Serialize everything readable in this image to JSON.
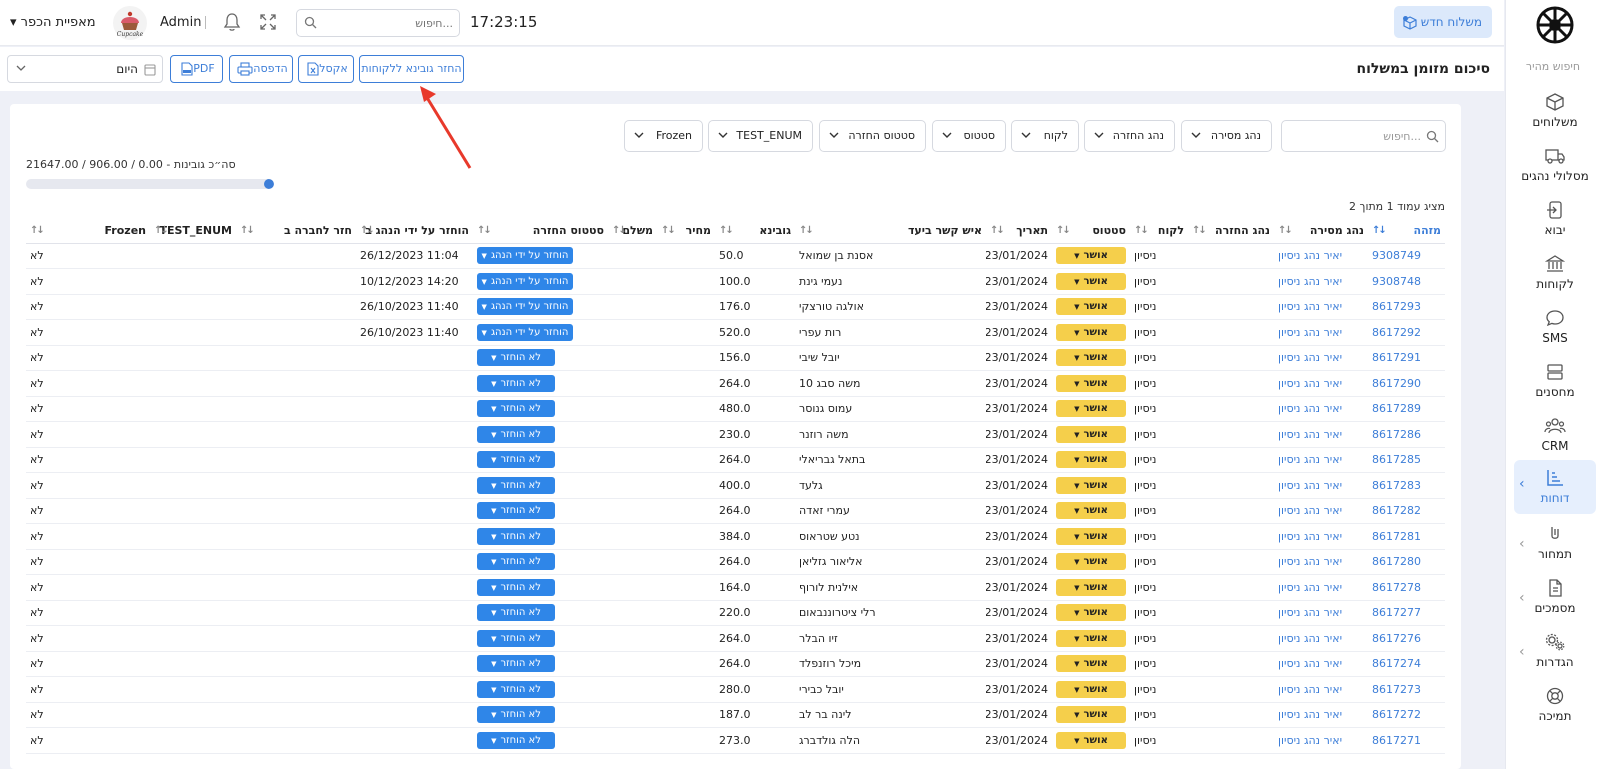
{
  "sidebar": {
    "quick_search": "חיפוש מהיר",
    "items": [
      {
        "label": "משלוחים",
        "icon": "box-icon"
      },
      {
        "label": "מסלולי נהגים",
        "icon": "truck-icon"
      },
      {
        "label": "יבוא",
        "icon": "import-icon"
      },
      {
        "label": "לקוחות",
        "icon": "bank-icon"
      },
      {
        "label": "SMS",
        "icon": "chat-icon"
      },
      {
        "label": "מחסנים",
        "icon": "warehouse-icon"
      },
      {
        "label": "CRM",
        "icon": "users-icon"
      },
      {
        "label": "דוחות",
        "icon": "report-icon"
      },
      {
        "label": "תמחור",
        "icon": "pricing-icon"
      },
      {
        "label": "מסמכים",
        "icon": "document-icon"
      },
      {
        "label": "הגדרות",
        "icon": "gear-icon"
      },
      {
        "label": "תמיכה",
        "icon": "support-icon"
      }
    ]
  },
  "header": {
    "new_shipment": "משלוח חדש",
    "time": "17:23:15",
    "search_placeholder": "חיפוש...",
    "user": "Admin",
    "brand_text": "Cupcake",
    "business": "מאפיית הכפר"
  },
  "toolbar": {
    "title": "סיכום מזומן במשלוח",
    "return_cash": "החזר גובינא ללקוחות",
    "excel": "אקסל",
    "print": "הדפסה",
    "pdf": "PDF",
    "date_value": "היום"
  },
  "filters": {
    "search_placeholder": "חיפוש...",
    "buttons": [
      "נהג מסירה",
      "נהג החזרה",
      "לקוח",
      "סטטוס",
      "סטטוס החזרה",
      "TEST_ENUM",
      "Frozen"
    ]
  },
  "totals": {
    "text": "סה״כ גובינות - 0.00 / 906.00 / 21647.00",
    "progress_fraction": 0.04
  },
  "page_info": "מציג עמוד 1 מתוך 2",
  "table": {
    "columns": [
      "מזהה",
      "נהג מסירה",
      "נהג החזרה",
      "לקוח",
      "סטטוס",
      "תאריך",
      "איש קשר ביעד",
      "גובינא",
      "מחיר",
      "משלם",
      "סטטוס החזרה",
      "הוחזר על ידי הנהג ב",
      "חזר לחברה ב",
      "TEST_ENUM",
      "Frozen"
    ],
    "rows": [
      {
        "id": "9308749",
        "driver": "יאיר נהג ניסיון",
        "return_driver": "",
        "customer": "ניסיון",
        "status": "אושר",
        "date": "23/01/2024",
        "contact": "אסנת בן שמואל",
        "cod": "50.0",
        "price": "",
        "payer": "",
        "return_status": "הוחזר על ידי הנהג",
        "returned_at": "11:04 26/12/2023",
        "company_at": "",
        "test_enum": "",
        "frozen": "לא"
      },
      {
        "id": "9308748",
        "driver": "יאיר נהג ניסיון",
        "return_driver": "",
        "customer": "ניסיון",
        "status": "אושר",
        "date": "23/01/2024",
        "contact": "נעמי גינת",
        "cod": "100.0",
        "price": "",
        "payer": "",
        "return_status": "הוחזר על ידי הנהג",
        "returned_at": "14:20 10/12/2023",
        "company_at": "",
        "test_enum": "",
        "frozen": "לא"
      },
      {
        "id": "8617293",
        "driver": "יאיר נהג ניסיון",
        "return_driver": "",
        "customer": "ניסיון",
        "status": "אושר",
        "date": "23/01/2024",
        "contact": "אולגה טורצקי",
        "cod": "176.0",
        "price": "",
        "payer": "",
        "return_status": "הוחזר על ידי הנהג",
        "returned_at": "11:40 26/10/2023",
        "company_at": "",
        "test_enum": "",
        "frozen": "לא"
      },
      {
        "id": "8617292",
        "driver": "יאיר נהג ניסיון",
        "return_driver": "",
        "customer": "ניסיון",
        "status": "אושר",
        "date": "23/01/2024",
        "contact": "רות עפרי",
        "cod": "520.0",
        "price": "",
        "payer": "",
        "return_status": "הוחזר על ידי הנהג",
        "returned_at": "11:40 26/10/2023",
        "company_at": "",
        "test_enum": "",
        "frozen": "לא"
      },
      {
        "id": "8617291",
        "driver": "יאיר נהג ניסיון",
        "return_driver": "",
        "customer": "ניסיון",
        "status": "אושר",
        "date": "23/01/2024",
        "contact": "יובל שיבי",
        "cod": "156.0",
        "price": "",
        "payer": "",
        "return_status": "לא הוחזר",
        "returned_at": "",
        "company_at": "",
        "test_enum": "",
        "frozen": "לא"
      },
      {
        "id": "8617290",
        "driver": "יאיר נהג ניסיון",
        "return_driver": "",
        "customer": "ניסיון",
        "status": "אושר",
        "date": "23/01/2024",
        "contact": "משה סבג 10",
        "cod": "264.0",
        "price": "",
        "payer": "",
        "return_status": "לא הוחזר",
        "returned_at": "",
        "company_at": "",
        "test_enum": "",
        "frozen": "לא"
      },
      {
        "id": "8617289",
        "driver": "יאיר נהג ניסיון",
        "return_driver": "",
        "customer": "ניסיון",
        "status": "אושר",
        "date": "23/01/2024",
        "contact": "עמוס גנוסר",
        "cod": "480.0",
        "price": "",
        "payer": "",
        "return_status": "לא הוחזר",
        "returned_at": "",
        "company_at": "",
        "test_enum": "",
        "frozen": "לא"
      },
      {
        "id": "8617286",
        "driver": "יאיר נהג ניסיון",
        "return_driver": "",
        "customer": "ניסיון",
        "status": "אושר",
        "date": "23/01/2024",
        "contact": "משה רוזנר",
        "cod": "230.0",
        "price": "",
        "payer": "",
        "return_status": "לא הוחזר",
        "returned_at": "",
        "company_at": "",
        "test_enum": "",
        "frozen": "לא"
      },
      {
        "id": "8617285",
        "driver": "יאיר נהג ניסיון",
        "return_driver": "",
        "customer": "ניסיון",
        "status": "אושר",
        "date": "23/01/2024",
        "contact": "בתאל גבריאלי",
        "cod": "264.0",
        "price": "",
        "payer": "",
        "return_status": "לא הוחזר",
        "returned_at": "",
        "company_at": "",
        "test_enum": "",
        "frozen": "לא"
      },
      {
        "id": "8617283",
        "driver": "יאיר נהג ניסיון",
        "return_driver": "",
        "customer": "ניסיון",
        "status": "אושר",
        "date": "23/01/2024",
        "contact": "גלעד",
        "cod": "400.0",
        "price": "",
        "payer": "",
        "return_status": "לא הוחזר",
        "returned_at": "",
        "company_at": "",
        "test_enum": "",
        "frozen": "לא"
      },
      {
        "id": "8617282",
        "driver": "יאיר נהג ניסיון",
        "return_driver": "",
        "customer": "ניסיון",
        "status": "אושר",
        "date": "23/01/2024",
        "contact": "עמרי זאדה",
        "cod": "264.0",
        "price": "",
        "payer": "",
        "return_status": "לא הוחזר",
        "returned_at": "",
        "company_at": "",
        "test_enum": "",
        "frozen": "לא"
      },
      {
        "id": "8617281",
        "driver": "יאיר נהג ניסיון",
        "return_driver": "",
        "customer": "ניסיון",
        "status": "אושר",
        "date": "23/01/2024",
        "contact": "נטע שטראוס",
        "cod": "384.0",
        "price": "",
        "payer": "",
        "return_status": "לא הוחזר",
        "returned_at": "",
        "company_at": "",
        "test_enum": "",
        "frozen": "לא"
      },
      {
        "id": "8617280",
        "driver": "יאיר נהג ניסיון",
        "return_driver": "",
        "customer": "ניסיון",
        "status": "אושר",
        "date": "23/01/2024",
        "contact": "אליאור גזליאן",
        "cod": "264.0",
        "price": "",
        "payer": "",
        "return_status": "לא הוחזר",
        "returned_at": "",
        "company_at": "",
        "test_enum": "",
        "frozen": "לא"
      },
      {
        "id": "8617278",
        "driver": "יאיר נהג ניסיון",
        "return_driver": "",
        "customer": "ניסיון",
        "status": "אושר",
        "date": "23/01/2024",
        "contact": "אילנית לורוף",
        "cod": "164.0",
        "price": "",
        "payer": "",
        "return_status": "לא הוחזר",
        "returned_at": "",
        "company_at": "",
        "test_enum": "",
        "frozen": "לא"
      },
      {
        "id": "8617277",
        "driver": "יאיר נהג ניסיון",
        "return_driver": "",
        "customer": "ניסיון",
        "status": "אושר",
        "date": "23/01/2024",
        "contact": "רלי ציטרוננבאום",
        "cod": "220.0",
        "price": "",
        "payer": "",
        "return_status": "לא הוחזר",
        "returned_at": "",
        "company_at": "",
        "test_enum": "",
        "frozen": "לא"
      },
      {
        "id": "8617276",
        "driver": "יאיר נהג ניסיון",
        "return_driver": "",
        "customer": "ניסיון",
        "status": "אושר",
        "date": "23/01/2024",
        "contact": "זיו הבלר",
        "cod": "264.0",
        "price": "",
        "payer": "",
        "return_status": "לא הוחזר",
        "returned_at": "",
        "company_at": "",
        "test_enum": "",
        "frozen": "לא"
      },
      {
        "id": "8617274",
        "driver": "יאיר נהג ניסיון",
        "return_driver": "",
        "customer": "ניסיון",
        "status": "אושר",
        "date": "23/01/2024",
        "contact": "מיכל רוזנפלד",
        "cod": "264.0",
        "price": "",
        "payer": "",
        "return_status": "לא הוחזר",
        "returned_at": "",
        "company_at": "",
        "test_enum": "",
        "frozen": "לא"
      },
      {
        "id": "8617273",
        "driver": "יאיר נהג ניסיון",
        "return_driver": "",
        "customer": "ניסיון",
        "status": "אושר",
        "date": "23/01/2024",
        "contact": "יובל כבירי",
        "cod": "280.0",
        "price": "",
        "payer": "",
        "return_status": "לא הוחזר",
        "returned_at": "",
        "company_at": "",
        "test_enum": "",
        "frozen": "לא"
      },
      {
        "id": "8617272",
        "driver": "יאיר נהג ניסיון",
        "return_driver": "",
        "customer": "ניסיון",
        "status": "אושר",
        "date": "23/01/2024",
        "contact": "לינה בר לב",
        "cod": "187.0",
        "price": "",
        "payer": "",
        "return_status": "לא הוחזר",
        "returned_at": "",
        "company_at": "",
        "test_enum": "",
        "frozen": "לא"
      },
      {
        "id": "8617271",
        "driver": "יאיר נהג ניסיון",
        "return_driver": "",
        "customer": "ניסיון",
        "status": "אושר",
        "date": "23/01/2024",
        "contact": "הלה גולדברג",
        "cod": "273.0",
        "price": "",
        "payer": "",
        "return_status": "לא הוחזר",
        "returned_at": "",
        "company_at": "",
        "test_enum": "",
        "frozen": "לא"
      }
    ]
  },
  "colors": {
    "accent": "#3d7ed8",
    "status_yellow": "#f5cf4b",
    "return_blue": "#2f86e8",
    "annotation_arrow": "#e8392b"
  }
}
